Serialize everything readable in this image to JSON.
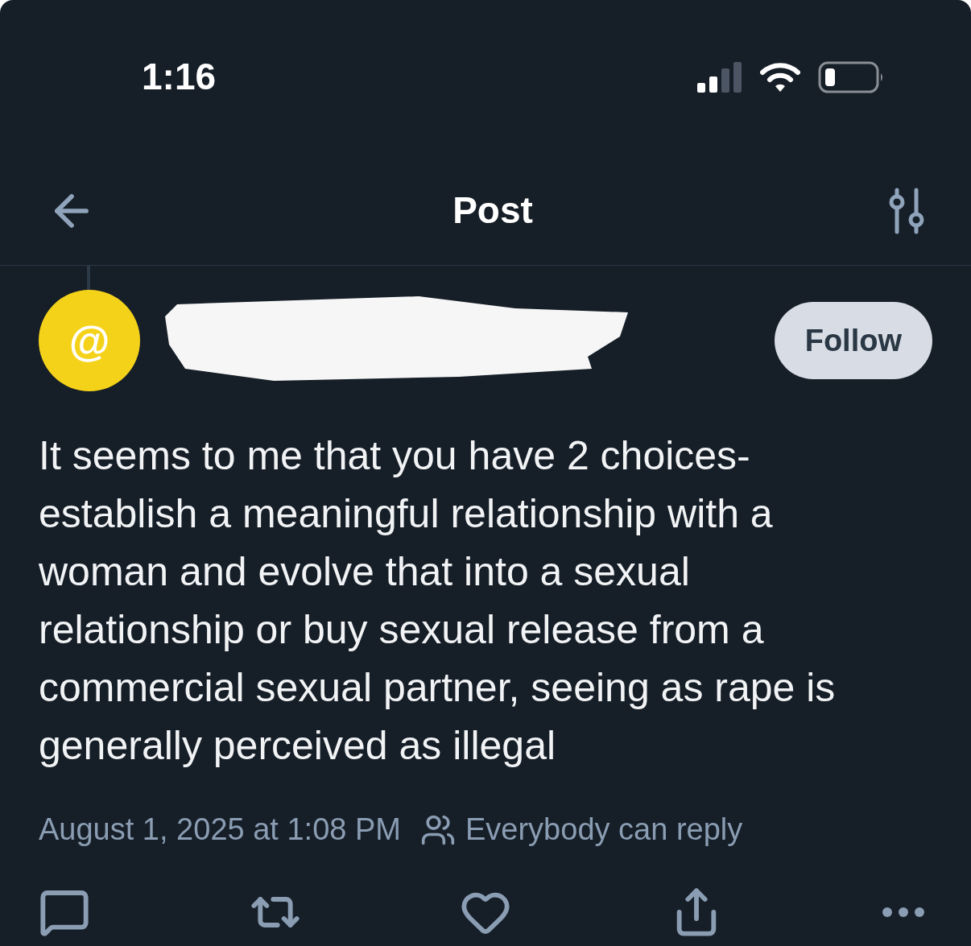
{
  "status_bar": {
    "time": "1:16"
  },
  "header": {
    "title": "Post"
  },
  "post": {
    "follow_button": "Follow",
    "avatar": "@",
    "text": "It seems to me that you have 2 choices- establish a meaningful relationship with a woman and evolve that into a sexual relationship or buy sexual release from a commercial sexual partner, seeing as rape is generally perceived as illegal",
    "timestamp": "August 1, 2025 at 1:08 PM",
    "reply_setting": "Everybody can reply"
  }
}
